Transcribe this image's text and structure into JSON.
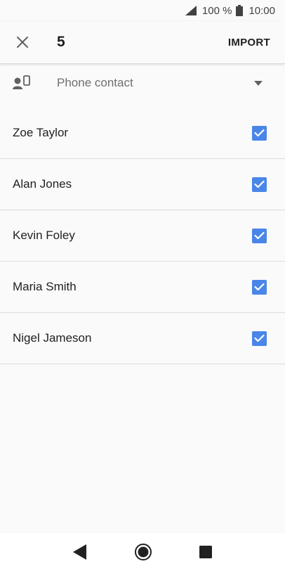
{
  "status_bar": {
    "battery_percent": "100 %",
    "time": "10:00",
    "icons": [
      "signal-icon",
      "battery-icon"
    ]
  },
  "app_bar": {
    "selected_count": "5",
    "import_label": "IMPORT",
    "close_icon": "close-icon"
  },
  "account_selector": {
    "label": "Phone contact",
    "icon": "phone-contact-icon"
  },
  "contacts": [
    {
      "name": "Zoe Taylor",
      "checked": true
    },
    {
      "name": "Alan Jones",
      "checked": true
    },
    {
      "name": "Kevin Foley",
      "checked": true
    },
    {
      "name": "Maria Smith",
      "checked": true
    },
    {
      "name": "Nigel Jameson",
      "checked": true
    }
  ],
  "colors": {
    "checkbox_accent": "#4a86e8",
    "background": "#fafafa"
  }
}
